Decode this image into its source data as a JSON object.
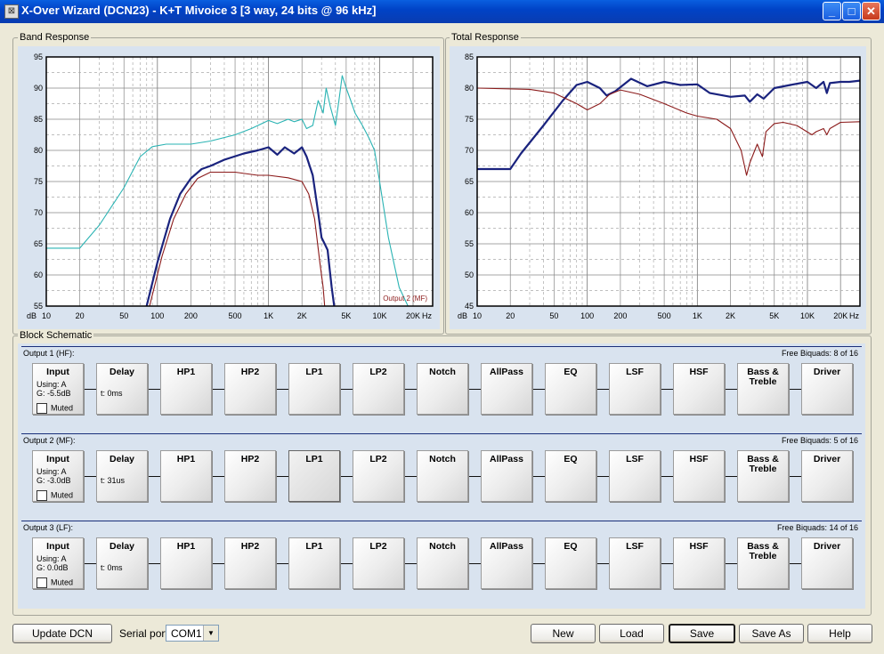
{
  "window": {
    "title": "X-Over Wizard (DCN23) - K+T Mivoice 3 [3 way, 24 bits @ 96 kHz]",
    "controls": [
      "minimize-icon",
      "maximize-icon",
      "close-icon"
    ]
  },
  "band_response": {
    "label": "Band Response",
    "series_label": "Output 2 (MF)"
  },
  "total_response": {
    "label": "Total Response"
  },
  "chart_data": [
    {
      "type": "line",
      "title": "",
      "x_scale": "log",
      "xlim": [
        10,
        30000
      ],
      "ylim": [
        55,
        95
      ],
      "ylabel": "dB",
      "xlabel": "Hz",
      "y_ticks": [
        55,
        60,
        65,
        70,
        75,
        80,
        85,
        90,
        95
      ],
      "x_tick_labels": [
        "10",
        "20",
        "50",
        "100",
        "200",
        "500",
        "1K",
        "2K",
        "5K",
        "10K",
        "20K"
      ],
      "grid": true,
      "series": [
        {
          "name": "",
          "color": "#2ab3b3",
          "points": [
            [
              10,
              64.3
            ],
            [
              20,
              64.3
            ],
            [
              30,
              68
            ],
            [
              50,
              74
            ],
            [
              70,
              79
            ],
            [
              90,
              80.6
            ],
            [
              120,
              81
            ],
            [
              200,
              81
            ],
            [
              300,
              81.5
            ],
            [
              500,
              82.5
            ],
            [
              700,
              83.5
            ],
            [
              1000,
              84.8
            ],
            [
              1200,
              84.3
            ],
            [
              1500,
              85
            ],
            [
              1700,
              84.6
            ],
            [
              2000,
              85
            ],
            [
              2200,
              83.5
            ],
            [
              2500,
              84
            ],
            [
              2800,
              88
            ],
            [
              3100,
              86
            ],
            [
              3300,
              90
            ],
            [
              3600,
              87
            ],
            [
              4000,
              84
            ],
            [
              4300,
              88
            ],
            [
              4600,
              92
            ],
            [
              5000,
              90
            ],
            [
              5500,
              88
            ],
            [
              6000,
              86
            ],
            [
              7000,
              84
            ],
            [
              8000,
              82
            ],
            [
              9000,
              80
            ],
            [
              10000,
              75
            ],
            [
              12000,
              66
            ],
            [
              15000,
              58
            ],
            [
              18000,
              55
            ]
          ]
        },
        {
          "name": "",
          "color": "#1a237e",
          "points": [
            [
              80,
              55
            ],
            [
              100,
              62
            ],
            [
              130,
              69
            ],
            [
              160,
              73
            ],
            [
              200,
              75.5
            ],
            [
              250,
              77
            ],
            [
              300,
              77.5
            ],
            [
              400,
              78.5
            ],
            [
              600,
              79.5
            ],
            [
              800,
              80
            ],
            [
              1000,
              80.5
            ],
            [
              1200,
              79.3
            ],
            [
              1400,
              80.5
            ],
            [
              1700,
              79.5
            ],
            [
              2000,
              80.5
            ],
            [
              2200,
              79
            ],
            [
              2500,
              76
            ],
            [
              2800,
              70
            ],
            [
              3000,
              66
            ],
            [
              3200,
              65
            ],
            [
              3400,
              64
            ],
            [
              3500,
              62
            ],
            [
              3700,
              58
            ],
            [
              3900,
              55
            ]
          ]
        },
        {
          "name": "",
          "color": "#8b1a1a",
          "points": [
            [
              85,
              55
            ],
            [
              110,
              63
            ],
            [
              140,
              69
            ],
            [
              180,
              73
            ],
            [
              230,
              75.5
            ],
            [
              300,
              76.5
            ],
            [
              500,
              76.5
            ],
            [
              800,
              76
            ],
            [
              1000,
              76
            ],
            [
              1500,
              75.6
            ],
            [
              2000,
              75
            ],
            [
              2300,
              73
            ],
            [
              2600,
              69
            ],
            [
              2900,
              62
            ],
            [
              3100,
              58
            ],
            [
              3200,
              55
            ]
          ]
        }
      ]
    },
    {
      "type": "line",
      "title": "",
      "x_scale": "log",
      "xlim": [
        10,
        30000
      ],
      "ylim": [
        45,
        85
      ],
      "ylabel": "dB",
      "xlabel": "Hz",
      "y_ticks": [
        45,
        50,
        55,
        60,
        65,
        70,
        75,
        80,
        85
      ],
      "x_tick_labels": [
        "10",
        "20",
        "50",
        "100",
        "200",
        "500",
        "1K",
        "2K",
        "5K",
        "10K",
        "20K"
      ],
      "grid": true,
      "series": [
        {
          "name": "",
          "color": "#1a237e",
          "points": [
            [
              10,
              67
            ],
            [
              20,
              67
            ],
            [
              25,
              69.5
            ],
            [
              40,
              74
            ],
            [
              60,
              78
            ],
            [
              80,
              80.5
            ],
            [
              100,
              81
            ],
            [
              130,
              80
            ],
            [
              150,
              78.8
            ],
            [
              180,
              79.5
            ],
            [
              250,
              81.5
            ],
            [
              350,
              80.3
            ],
            [
              500,
              81
            ],
            [
              700,
              80.5
            ],
            [
              1000,
              80.6
            ],
            [
              1300,
              79.2
            ],
            [
              2000,
              78.6
            ],
            [
              2700,
              78.8
            ],
            [
              3000,
              77.8
            ],
            [
              3500,
              79
            ],
            [
              4000,
              78.3
            ],
            [
              5000,
              80
            ],
            [
              7000,
              80.5
            ],
            [
              10000,
              81
            ],
            [
              12000,
              80
            ],
            [
              14000,
              81
            ],
            [
              15000,
              79.2
            ],
            [
              16000,
              80.8
            ],
            [
              20000,
              81
            ],
            [
              24000,
              81
            ],
            [
              30000,
              81.2
            ]
          ]
        },
        {
          "name": "",
          "color": "#8b1a1a",
          "points": [
            [
              10,
              80
            ],
            [
              30,
              79.8
            ],
            [
              50,
              79.2
            ],
            [
              80,
              77.5
            ],
            [
              100,
              76.5
            ],
            [
              130,
              77.5
            ],
            [
              160,
              79
            ],
            [
              200,
              79.7
            ],
            [
              300,
              79
            ],
            [
              500,
              77.5
            ],
            [
              800,
              76
            ],
            [
              1000,
              75.5
            ],
            [
              1500,
              75
            ],
            [
              2000,
              73.5
            ],
            [
              2500,
              70
            ],
            [
              2800,
              66
            ],
            [
              3000,
              68
            ],
            [
              3500,
              71
            ],
            [
              3900,
              69
            ],
            [
              4200,
              73
            ],
            [
              5000,
              74.3
            ],
            [
              6000,
              74.5
            ],
            [
              8000,
              74
            ],
            [
              11000,
              72.5
            ],
            [
              12000,
              73
            ],
            [
              14000,
              73.5
            ],
            [
              15000,
              72.5
            ],
            [
              16000,
              73.5
            ],
            [
              20000,
              74.5
            ],
            [
              30000,
              74.6
            ]
          ]
        }
      ]
    }
  ],
  "block_schematic": {
    "label": "Block Schematic",
    "block_labels": [
      "Input",
      "Delay",
      "HP1",
      "HP2",
      "LP1",
      "LP2",
      "Notch",
      "AllPass",
      "EQ",
      "LSF",
      "HSF",
      "Bass & Treble",
      "Driver"
    ],
    "rows": [
      {
        "label": "Output 1 (HF):",
        "free": "Free Biquads: 8 of 16",
        "using": "Using: A",
        "gain": "G: -5.5dB",
        "muted": "Muted",
        "delay": "t: 0ms",
        "selected": ""
      },
      {
        "label": "Output 2 (MF):",
        "free": "Free Biquads: 5 of 16",
        "using": "Using: A",
        "gain": "G: -3.0dB",
        "muted": "Muted",
        "delay": "t: 31us",
        "selected": "LP1"
      },
      {
        "label": "Output 3 (LF):",
        "free": "Free Biquads: 14 of 16",
        "using": "Using: A",
        "gain": "G: 0.0dB",
        "muted": "Muted",
        "delay": "t: 0ms",
        "selected": ""
      }
    ]
  },
  "footer": {
    "update_label": "Update DCN",
    "serial_label": "Serial port",
    "serial_value": "COM1",
    "new_label": "New",
    "load_label": "Load",
    "save_label": "Save",
    "save_as_label": "Save As",
    "help_label": "Help"
  }
}
